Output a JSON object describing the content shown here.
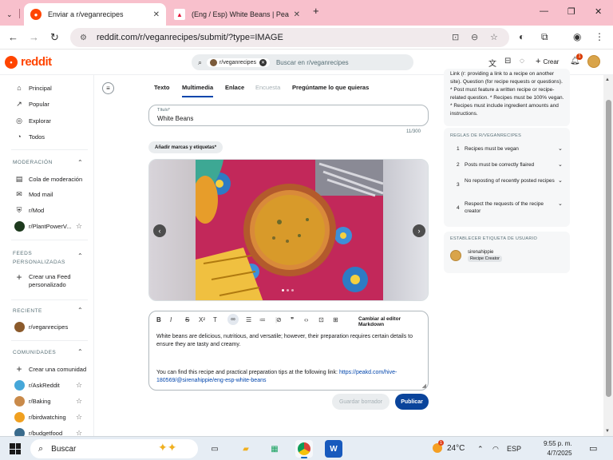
{
  "browser": {
    "tabs": [
      {
        "title": "Enviar a r/veganrecipes",
        "active": true
      },
      {
        "title": "(Eng / Esp) White Beans | PeakD",
        "active": false
      }
    ],
    "new_tab": "+",
    "url": "reddit.com/r/veganrecipes/submit/?type=IMAGE"
  },
  "header": {
    "logo": "reddit",
    "search_chip": "r/veganrecipes",
    "search_placeholder": "Buscar en r/veganrecipes",
    "create_label": "Crear",
    "notification_count": "1"
  },
  "sidebar": {
    "main": [
      {
        "label": "Principal",
        "icon": "home-icon"
      },
      {
        "label": "Popular",
        "icon": "popular-icon"
      },
      {
        "label": "Explorar",
        "icon": "explore-icon"
      },
      {
        "label": "Todos",
        "icon": "all-icon"
      }
    ],
    "moderation_header": "MODERACIÓN",
    "moderation": [
      {
        "label": "Cola de moderación",
        "icon": "queue-icon"
      },
      {
        "label": "Mod mail",
        "icon": "mail-icon"
      },
      {
        "label": "r/Mod",
        "icon": "mod-icon"
      },
      {
        "label": "r/PlantPowerV...",
        "icon": "community-avatar"
      }
    ],
    "feeds_header": "FEEDS PERSONALIZADAS",
    "create_feed": "Crear una Feed personalizado",
    "recent_header": "RECIENTE",
    "recent": [
      {
        "label": "r/veganrecipes"
      }
    ],
    "communities_header": "COMUNIDADES",
    "create_community": "Crear una comunidad",
    "communities": [
      {
        "label": "r/AskReddit"
      },
      {
        "label": "r/Baking"
      },
      {
        "label": "r/birdwatching"
      },
      {
        "label": "r/budgetfood"
      }
    ]
  },
  "post": {
    "tabs": [
      "Texto",
      "Multimedia",
      "Enlace",
      "Encuesta",
      "Pregúntame lo que quieras"
    ],
    "active_tab": "Multimedia",
    "title_label": "Título*",
    "title_value": "White Beans",
    "char_count": "11/300",
    "tags_button": "Añadir marcas y etiquetas*",
    "editor_switch": "Cambiar al editor Markdown",
    "body_paragraph": "White beans are delicious, nutritious, and versatile; however, their preparation requires certain details to ensure they are tasty and creamy.",
    "body_link_prefix": "You can find this recipe and practical preparation tips at the following link: ",
    "body_link": "https://peakd.com/hive-180569/@sirenahippie/eng-esp-white-beans",
    "save_draft": "Guardar borrador",
    "publish": "Publicar"
  },
  "right": {
    "about_text": "Link (r: providing a link to a recipe on another site). Question (for recipe requests or questions). * Post must feature a written recipe or recipe-related question. * Recipes must be 100% vegan. * Recipes must include ingredient amounts and instructions.",
    "rules_header": "REGLAS DE R/VEGANRECIPES",
    "rules": [
      {
        "n": "1",
        "text": "Recipes must be vegan"
      },
      {
        "n": "2",
        "text": "Posts must be correctly flaired"
      },
      {
        "n": "3",
        "text": "No reposting of recently posted recipes"
      },
      {
        "n": "4",
        "text": "Respect the requests of the recipe creator"
      }
    ],
    "flair_header": "ESTABLECER ETIQUETA DE USUARIO",
    "username": "sirenahippie",
    "flair": "Recipe Creator"
  },
  "taskbar": {
    "search": "Buscar",
    "temperature": "24°C",
    "weather_badge": "1",
    "language": "ESP",
    "time": "9:55 p. m.",
    "date": "4/7/2025"
  },
  "colors": {
    "reddit_orange": "#ff4500",
    "publish_blue": "#0a449b",
    "tab_strip": "#f8c0cc"
  }
}
